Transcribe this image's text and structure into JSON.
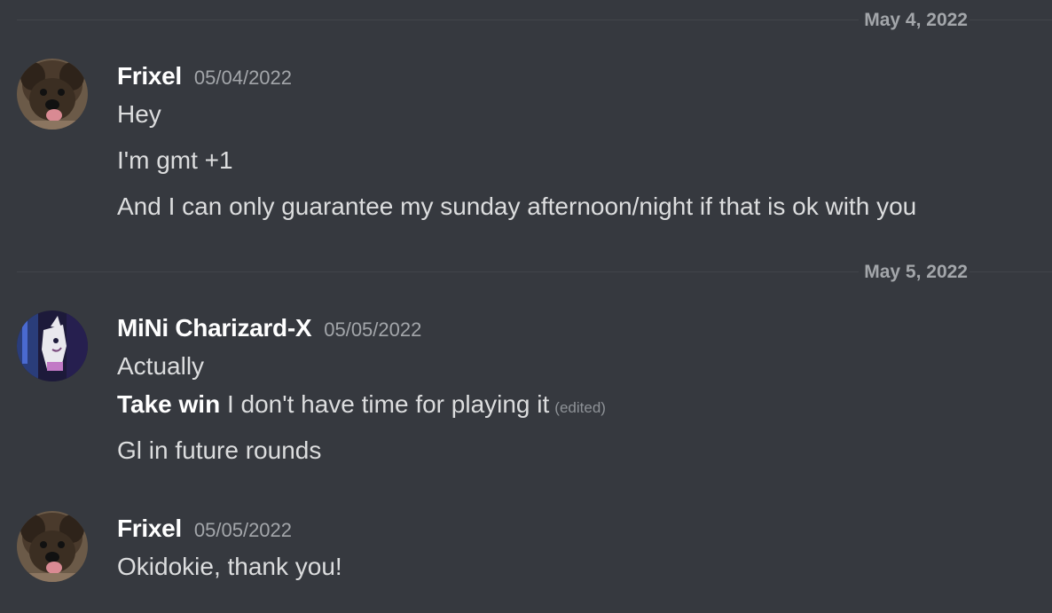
{
  "dividers": [
    {
      "date": "May 4, 2022"
    },
    {
      "date": "May 5, 2022"
    }
  ],
  "messages": [
    {
      "username": "Frixel",
      "timestamp": "05/04/2022",
      "avatar": "dog-avatar",
      "lines": [
        "Hey",
        "I'm gmt +1",
        "And I can only guarantee my sunday afternoon/night if that is ok with you"
      ]
    },
    {
      "username": "MiNi Charizard-X",
      "timestamp": "05/05/2022",
      "avatar": "ghost-pokemon-avatar",
      "lines": [
        "Actually",
        {
          "bold": "Take win",
          "rest": " I don't have time for playing it",
          "edited": "(edited)"
        },
        "Gl in future rounds"
      ]
    },
    {
      "username": "Frixel",
      "timestamp": "05/05/2022",
      "avatar": "dog-avatar",
      "lines": [
        "Okidokie, thank you!"
      ]
    }
  ],
  "colors": {
    "background": "#36393f",
    "username": "#ffffff",
    "text": "#dcddde",
    "muted": "#a3a6aa",
    "divider": "#42454a"
  }
}
